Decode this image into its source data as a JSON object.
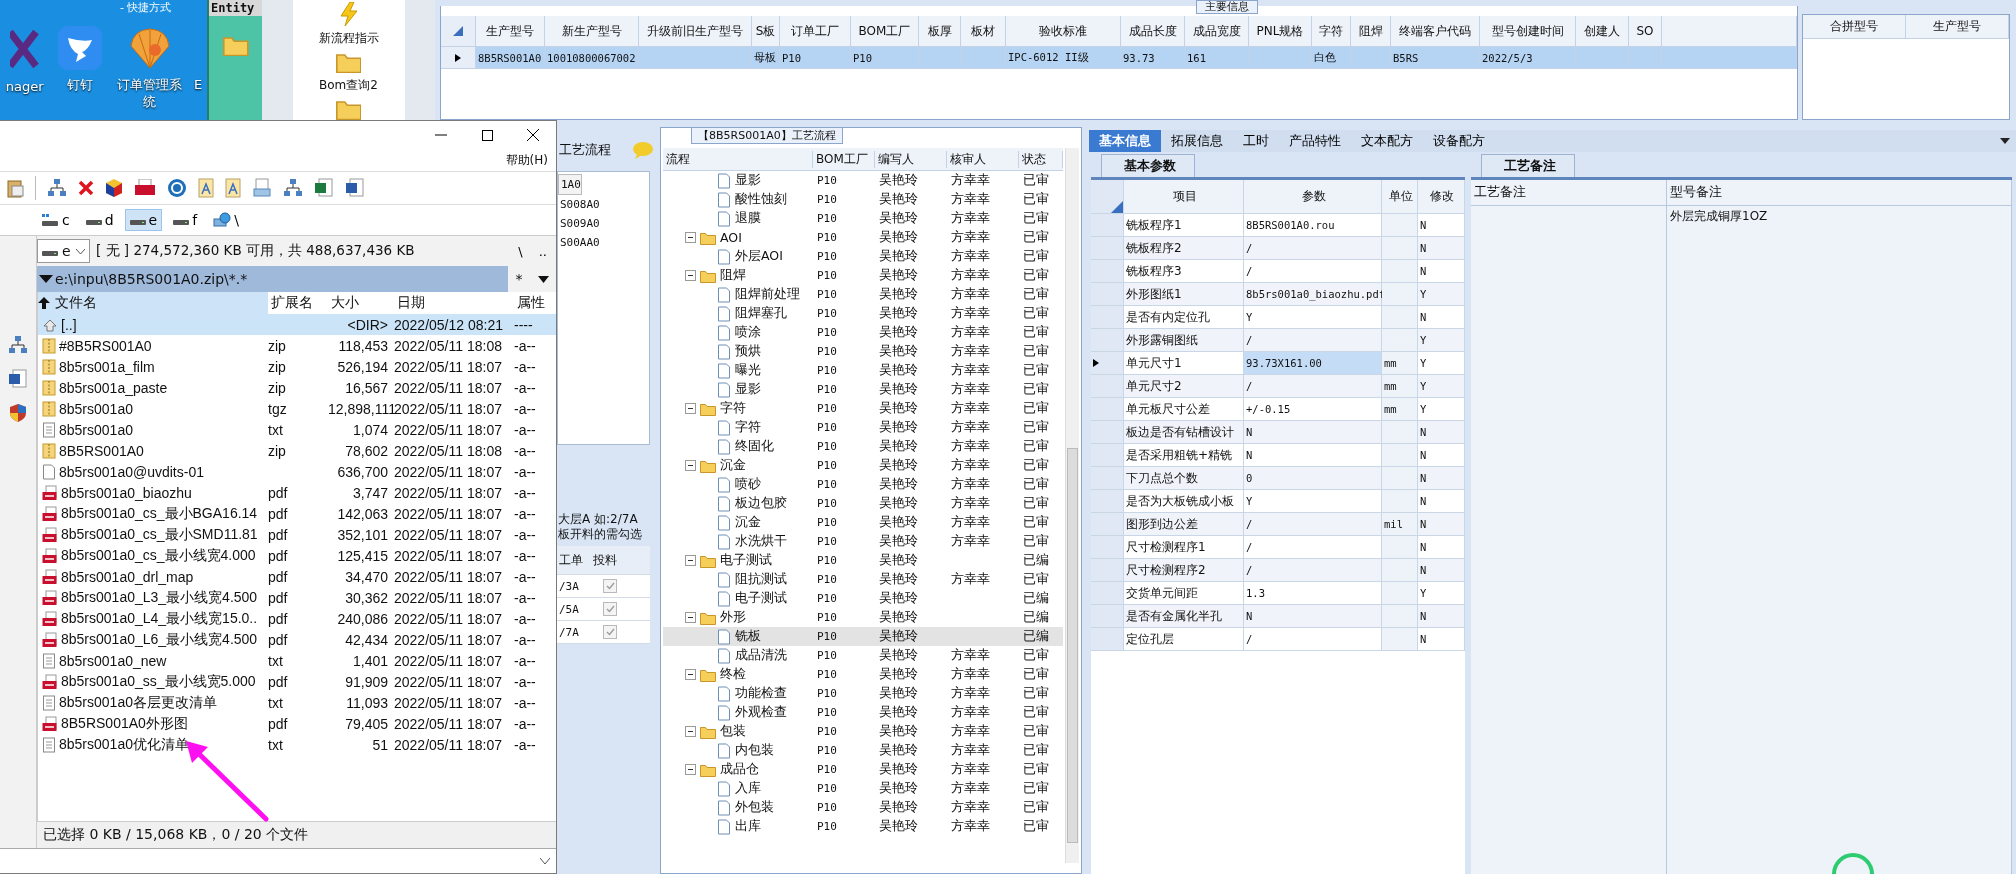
{
  "desktop": {
    "top_label": "- 快捷方式",
    "icons": [
      {
        "label": "nager",
        "kind": "x"
      },
      {
        "label": "钉钉",
        "kind": "wing"
      },
      {
        "label": "订单管理系统",
        "kind": "shell"
      },
      {
        "label": "E",
        "kind": "none"
      }
    ]
  },
  "entity_window": {
    "title": "Entity"
  },
  "launcher": {
    "items": [
      {
        "label": "新流程指示",
        "kind": "lightning"
      },
      {
        "label": "Bom查询2",
        "kind": "folder"
      },
      {
        "kind": "folder"
      }
    ]
  },
  "main_info": {
    "title": "主要信息",
    "columns": [
      "生产型号",
      "新生产型号",
      "升级前旧生产型号",
      "S板",
      "订单工厂",
      "BOM工厂",
      "板厚",
      "板材",
      "验收标准",
      "成品长度",
      "成品宽度",
      "PNL规格",
      "字符",
      "阻焊",
      "终端客户代码",
      "型号创建时间",
      "创建人",
      "SO"
    ],
    "rows": [
      {
        "selected": true,
        "cells": [
          "8B5RS001A0",
          "10010800067002",
          null,
          "母板",
          "P10",
          "P10",
          null,
          null,
          "IPC-6012 II级",
          "93.73",
          "161",
          null,
          "白色",
          null,
          "B5RS",
          "2022/5/3",
          null,
          null
        ]
      }
    ]
  },
  "merge_table": {
    "columns": [
      "合拼型号",
      "生产型号"
    ]
  },
  "process_panel": {
    "title": "工艺流程",
    "list": [
      {
        "label": "1A0",
        "selected": true
      },
      {
        "label": "S008A0",
        "selected": false
      },
      {
        "label": "S009A0",
        "selected": false
      },
      {
        "label": "S00AA0",
        "selected": false
      }
    ],
    "notes": [
      "大层A 如:2/7A",
      "板开料的需勾选"
    ],
    "columns": [
      "工单",
      "投料"
    ],
    "rows": [
      {
        "order": "/3A",
        "checked": true
      },
      {
        "order": "/5A",
        "checked": true
      },
      {
        "order": "/7A",
        "checked": true
      }
    ]
  },
  "flow": {
    "title": "【8B5RS001A0】工艺流程",
    "columns": [
      "流程",
      "BOM工厂",
      "编写人",
      "核审人",
      "状态"
    ],
    "tree": [
      {
        "children": [
          {
            "label": "显影",
            "factory": "P10",
            "author": "吴艳玲",
            "reviewer": "方幸幸",
            "status": "已审",
            "selected": false
          },
          {
            "label": "酸性蚀刻",
            "factory": "P10",
            "author": "吴艳玲",
            "reviewer": "方幸幸",
            "status": "已审",
            "selected": false
          },
          {
            "label": "退膜",
            "factory": "P10",
            "author": "吴艳玲",
            "reviewer": "方幸幸",
            "status": "已审",
            "selected": false
          }
        ]
      },
      {
        "label": "AOI",
        "factory": "P10",
        "author": "吴艳玲",
        "reviewer": "方幸幸",
        "status": "已审",
        "selected": false,
        "expanded": true,
        "children": [
          {
            "label": "外层AOI",
            "factory": "P10",
            "author": "吴艳玲",
            "reviewer": "方幸幸",
            "status": "已审",
            "selected": false
          }
        ]
      },
      {
        "label": "阻焊",
        "factory": "P10",
        "author": "吴艳玲",
        "reviewer": "方幸幸",
        "status": "已审",
        "selected": false,
        "expanded": true,
        "children": [
          {
            "label": "阻焊前处理",
            "factory": "P10",
            "author": "吴艳玲",
            "reviewer": "方幸幸",
            "status": "已审",
            "selected": false
          },
          {
            "label": "阻焊塞孔",
            "factory": "P10",
            "author": "吴艳玲",
            "reviewer": "方幸幸",
            "status": "已审",
            "selected": false
          },
          {
            "label": "喷涂",
            "factory": "P10",
            "author": "吴艳玲",
            "reviewer": "方幸幸",
            "status": "已审",
            "selected": false
          },
          {
            "label": "预烘",
            "factory": "P10",
            "author": "吴艳玲",
            "reviewer": "方幸幸",
            "status": "已审",
            "selected": false
          },
          {
            "label": "曝光",
            "factory": "P10",
            "author": "吴艳玲",
            "reviewer": "方幸幸",
            "status": "已审",
            "selected": false
          },
          {
            "label": "显影",
            "factory": "P10",
            "author": "吴艳玲",
            "reviewer": "方幸幸",
            "status": "已审",
            "selected": false
          }
        ]
      },
      {
        "label": "字符",
        "factory": "P10",
        "author": "吴艳玲",
        "reviewer": "方幸幸",
        "status": "已审",
        "selected": false,
        "expanded": true,
        "children": [
          {
            "label": "字符",
            "factory": "P10",
            "author": "吴艳玲",
            "reviewer": "方幸幸",
            "status": "已审",
            "selected": false
          },
          {
            "label": "终固化",
            "factory": "P10",
            "author": "吴艳玲",
            "reviewer": "方幸幸",
            "status": "已审",
            "selected": false
          }
        ]
      },
      {
        "label": "沉金",
        "factory": "P10",
        "author": "吴艳玲",
        "reviewer": "方幸幸",
        "status": "已审",
        "selected": false,
        "expanded": true,
        "children": [
          {
            "label": "喷砂",
            "factory": "P10",
            "author": "吴艳玲",
            "reviewer": "方幸幸",
            "status": "已审",
            "selected": false
          },
          {
            "label": "板边包胶",
            "factory": "P10",
            "author": "吴艳玲",
            "reviewer": "方幸幸",
            "status": "已审",
            "selected": false
          },
          {
            "label": "沉金",
            "factory": "P10",
            "author": "吴艳玲",
            "reviewer": "方幸幸",
            "status": "已审",
            "selected": false
          },
          {
            "label": "水洗烘干",
            "factory": "P10",
            "author": "吴艳玲",
            "reviewer": "方幸幸",
            "status": "已审",
            "selected": false
          }
        ]
      },
      {
        "label": "电子测试",
        "factory": "P10",
        "author": "吴艳玲",
        "status": "已编",
        "selected": false,
        "expanded": true,
        "children": [
          {
            "label": "阻抗测试",
            "factory": "P10",
            "author": "吴艳玲",
            "reviewer": "方幸幸",
            "status": "已审",
            "selected": false
          },
          {
            "label": "电子测试",
            "factory": "P10",
            "author": "吴艳玲",
            "status": "已编",
            "selected": false
          }
        ]
      },
      {
        "label": "外形",
        "factory": "P10",
        "author": "吴艳玲",
        "status": "已编",
        "selected": false,
        "expanded": true,
        "children": [
          {
            "label": "铣板",
            "factory": "P10",
            "author": "吴艳玲",
            "status": "已编",
            "selected": true
          },
          {
            "label": "成品清洗",
            "factory": "P10",
            "author": "吴艳玲",
            "reviewer": "方幸幸",
            "status": "已审",
            "selected": false
          }
        ]
      },
      {
        "label": "终检",
        "factory": "P10",
        "author": "吴艳玲",
        "reviewer": "方幸幸",
        "status": "已审",
        "selected": false,
        "expanded": true,
        "children": [
          {
            "label": "功能检查",
            "factory": "P10",
            "author": "吴艳玲",
            "reviewer": "方幸幸",
            "status": "已审",
            "selected": false
          },
          {
            "label": "外观检查",
            "factory": "P10",
            "author": "吴艳玲",
            "reviewer": "方幸幸",
            "status": "已审",
            "selected": false
          }
        ]
      },
      {
        "label": "包装",
        "factory": "P10",
        "author": "吴艳玲",
        "reviewer": "方幸幸",
        "status": "已审",
        "selected": false,
        "expanded": true,
        "children": [
          {
            "label": "内包装",
            "factory": "P10",
            "author": "吴艳玲",
            "reviewer": "方幸幸",
            "status": "已审",
            "selected": false
          }
        ]
      },
      {
        "label": "成品仓",
        "factory": "P10",
        "author": "吴艳玲",
        "reviewer": "方幸幸",
        "status": "已审",
        "selected": false,
        "expanded": true,
        "children": [
          {
            "label": "入库",
            "factory": "P10",
            "author": "吴艳玲",
            "reviewer": "方幸幸",
            "status": "已审",
            "selected": false
          },
          {
            "label": "外包装",
            "factory": "P10",
            "author": "吴艳玲",
            "reviewer": "方幸幸",
            "status": "已审",
            "selected": false
          },
          {
            "label": "出库",
            "factory": "P10",
            "author": "吴艳玲",
            "reviewer": "方幸幸",
            "status": "已审",
            "selected": false
          }
        ]
      }
    ]
  },
  "tabs": [
    {
      "label": "基本信息",
      "selected": true
    },
    {
      "label": "拓展信息",
      "selected": false
    },
    {
      "label": "工时",
      "selected": false
    },
    {
      "label": "产品特性",
      "selected": false
    },
    {
      "label": "文本配方",
      "selected": false
    },
    {
      "label": "设备配方",
      "selected": false
    }
  ],
  "params": {
    "tab": "基本参数",
    "columns": [
      "项目",
      "参数",
      "单位",
      "修改"
    ],
    "rows": [
      {
        "item": "铣板程序1",
        "value": "8B5RS001A0.rou",
        "modified": "N",
        "selected": false
      },
      {
        "item": "铣板程序2",
        "value": "/",
        "modified": "N",
        "selected": false
      },
      {
        "item": "铣板程序3",
        "value": "/",
        "modified": "N",
        "selected": false
      },
      {
        "item": "外形图纸1",
        "value": "8b5rs001a0_biaozhu.pdf",
        "modified": "Y",
        "selected": false
      },
      {
        "item": "是否有内定位孔",
        "value": "Y",
        "modified": "N",
        "selected": false
      },
      {
        "item": "外形露铜图纸",
        "value": "/",
        "modified": "Y",
        "selected": false
      },
      {
        "item": "单元尺寸1",
        "value": "93.73X161.00",
        "unit": "mm",
        "modified": "Y",
        "selected": true
      },
      {
        "item": "单元尺寸2",
        "value": "/",
        "unit": "mm",
        "modified": "Y",
        "selected": false
      },
      {
        "item": "单元板尺寸公差",
        "value": "+/-0.15",
        "unit": "mm",
        "modified": "Y",
        "selected": false
      },
      {
        "item": "板边是否有钻槽设计",
        "value": "N",
        "modified": "N",
        "selected": false
      },
      {
        "item": "是否采用粗铣+精铣",
        "value": "N",
        "modified": "N",
        "selected": false
      },
      {
        "item": "下刀点总个数",
        "value": "0",
        "modified": "N",
        "selected": false
      },
      {
        "item": "是否为大板铣成小板",
        "value": "Y",
        "modified": "N",
        "selected": false
      },
      {
        "item": "图形到边公差",
        "value": "/",
        "unit": "mil",
        "modified": "N",
        "selected": false
      },
      {
        "item": "尺寸检测程序1",
        "value": "/",
        "modified": "N",
        "selected": false
      },
      {
        "item": "尺寸检测程序2",
        "value": "/",
        "modified": "N",
        "selected": false
      },
      {
        "item": "交货单元间距",
        "value": "1.3",
        "modified": "Y",
        "selected": false
      },
      {
        "item": "是否有金属化半孔",
        "value": "N",
        "modified": "N",
        "selected": false
      },
      {
        "item": "定位孔层",
        "value": "/",
        "modified": "N",
        "selected": false
      }
    ]
  },
  "remarks": {
    "tab": "工艺备注",
    "columns": [
      "工艺备注",
      "型号备注"
    ],
    "model_remark": "外层完成铜厚1OZ"
  },
  "file_manager": {
    "menu": [
      "帮助(H)"
    ],
    "drives": [
      {
        "label": "c",
        "kind": "system",
        "selected": false
      },
      {
        "label": "d",
        "kind": "disk",
        "selected": false
      },
      {
        "label": "e",
        "kind": "disk",
        "selected": true
      },
      {
        "label": "f",
        "kind": "disk",
        "selected": false
      },
      {
        "label": "\\",
        "kind": "network",
        "selected": false
      }
    ],
    "drive_combo": "e",
    "free_space": "[ 无 ]  274,572,360 KB 可用，共 488,637,436 KB",
    "nav": [
      "\\",
      ".."
    ],
    "path": "e:\\inpu\\8B5RS001A0.zip\\*.*",
    "filter": "*",
    "columns": [
      "文件名",
      "扩展名",
      "大小",
      "日期",
      "属性"
    ],
    "files": [
      {
        "name": "[..]",
        "kind": "up",
        "size": "<DIR>",
        "date": "2022/05/12 08:21",
        "attr": "----",
        "selected": true
      },
      {
        "name": "#8B5RS001A0",
        "kind": "zip",
        "ext": "zip",
        "size": "118,453",
        "date": "2022/05/11 18:08",
        "attr": "-a--",
        "selected": false
      },
      {
        "name": "8b5rs001a_film",
        "kind": "zip",
        "ext": "zip",
        "size": "526,194",
        "date": "2022/05/11 18:07",
        "attr": "-a--",
        "selected": false
      },
      {
        "name": "8b5rs001a_paste",
        "kind": "zip",
        "ext": "zip",
        "size": "16,567",
        "date": "2022/05/11 18:07",
        "attr": "-a--",
        "selected": false
      },
      {
        "name": "8b5rs001a0",
        "kind": "zip",
        "ext": "tgz",
        "size": "12,898,111",
        "date": "2022/05/11 18:07",
        "attr": "-a--",
        "selected": false
      },
      {
        "name": "8b5rs001a0",
        "kind": "txt",
        "ext": "txt",
        "size": "1,074",
        "date": "2022/05/11 18:07",
        "attr": "-a--",
        "selected": false
      },
      {
        "name": "8B5RS001A0",
        "kind": "zip",
        "ext": "zip",
        "size": "78,602",
        "date": "2022/05/11 18:08",
        "attr": "-a--",
        "selected": false
      },
      {
        "name": "8b5rs001a0@uvdits-01",
        "kind": "file",
        "size": "636,700",
        "date": "2022/05/11 18:07",
        "attr": "-a--",
        "selected": false
      },
      {
        "name": "8b5rs001a0_biaozhu",
        "kind": "pdf",
        "ext": "pdf",
        "size": "3,747",
        "date": "2022/05/11 18:07",
        "attr": "-a--",
        "selected": false
      },
      {
        "name": "8b5rs001a0_cs_最小BGA16.14",
        "kind": "pdf",
        "ext": "pdf",
        "size": "142,063",
        "date": "2022/05/11 18:07",
        "attr": "-a--",
        "selected": false
      },
      {
        "name": "8b5rs001a0_cs_最小SMD11.81",
        "kind": "pdf",
        "ext": "pdf",
        "size": "352,101",
        "date": "2022/05/11 18:07",
        "attr": "-a--",
        "selected": false
      },
      {
        "name": "8b5rs001a0_cs_最小线宽4.000",
        "kind": "pdf",
        "ext": "pdf",
        "size": "125,415",
        "date": "2022/05/11 18:07",
        "attr": "-a--",
        "selected": false
      },
      {
        "name": "8b5rs001a0_drl_map",
        "kind": "pdf",
        "ext": "pdf",
        "size": "34,470",
        "date": "2022/05/11 18:07",
        "attr": "-a--",
        "selected": false
      },
      {
        "name": "8b5rs001a0_L3_最小线宽4.500",
        "kind": "pdf",
        "ext": "pdf",
        "size": "30,362",
        "date": "2022/05/11 18:07",
        "attr": "-a--",
        "selected": false
      },
      {
        "name": "8b5rs001a0_L4_最小线宽15.0..",
        "kind": "pdf",
        "ext": "pdf",
        "size": "240,086",
        "date": "2022/05/11 18:07",
        "attr": "-a--",
        "selected": false
      },
      {
        "name": "8b5rs001a0_L6_最小线宽4.500",
        "kind": "pdf",
        "ext": "pdf",
        "size": "42,434",
        "date": "2022/05/11 18:07",
        "attr": "-a--",
        "selected": false
      },
      {
        "name": "8b5rs001a0_new",
        "kind": "txt",
        "ext": "txt",
        "size": "1,401",
        "date": "2022/05/11 18:07",
        "attr": "-a--",
        "selected": false
      },
      {
        "name": "8b5rs001a0_ss_最小线宽5.000",
        "kind": "pdf",
        "ext": "pdf",
        "size": "91,909",
        "date": "2022/05/11 18:07",
        "attr": "-a--",
        "selected": false
      },
      {
        "name": "8b5rs001a0各层更改清单",
        "kind": "txt",
        "ext": "txt",
        "size": "11,093",
        "date": "2022/05/11 18:07",
        "attr": "-a--",
        "selected": false
      },
      {
        "name": "8B5RS001A0外形图",
        "kind": "pdf",
        "ext": "pdf",
        "size": "79,405",
        "date": "2022/05/11 18:07",
        "attr": "-a--",
        "selected": false
      },
      {
        "name": "8b5rs001a0优化清单",
        "kind": "txt",
        "ext": "txt",
        "size": "51",
        "date": "2022/05/11 18:07",
        "attr": "-a--",
        "selected": false
      }
    ],
    "status": "已选择 0 KB / 15,068 KB，0 / 20 个文件"
  }
}
